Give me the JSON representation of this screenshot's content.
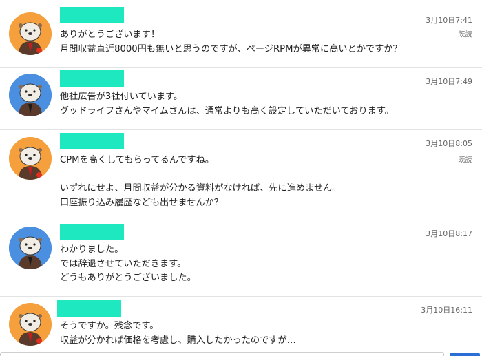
{
  "messages": [
    {
      "avatar": "otter-avatar-orange",
      "avatar_bg": "#f5a03c",
      "time": "3月10日7:41",
      "read": "既読",
      "text": "ありがとうございます！\n月間収益直近8000円も無いと思うのですが、ページRPMが異常に高いとかですか？"
    },
    {
      "avatar": "otter-avatar-blue",
      "avatar_bg": "#4a8fe0",
      "time": "3月10日7:49",
      "read": "",
      "text": "他社広告が3社付いています。\nグッドライフさんやマイムさんは、通常よりも高く設定していただいております。"
    },
    {
      "avatar": "otter-avatar-orange",
      "avatar_bg": "#f5a03c",
      "time": "3月10日8:05",
      "read": "既読",
      "text": "CPMを高くしてもらってるんですね。\n\nいずれにせよ、月間収益が分かる資料がなければ、先に進めません。\n口座振り込み履歴なども出せませんか？"
    },
    {
      "avatar": "otter-avatar-blue",
      "avatar_bg": "#4a8fe0",
      "time": "3月10日8:17",
      "read": "",
      "text": "わかりました。\nでは辞退させていただきます。\nどうもありがとうございました。"
    },
    {
      "avatar": "otter-avatar-orange",
      "avatar_bg": "#f5a03c",
      "time": "3月10日16:11",
      "read": "",
      "text": "そうですか。残念です。\n収益が分かれば価格を考慮し、購入したかったのですが…"
    }
  ],
  "colors": {
    "name_mask": "#1ee8c0",
    "send_button": "#2b6fd6"
  }
}
